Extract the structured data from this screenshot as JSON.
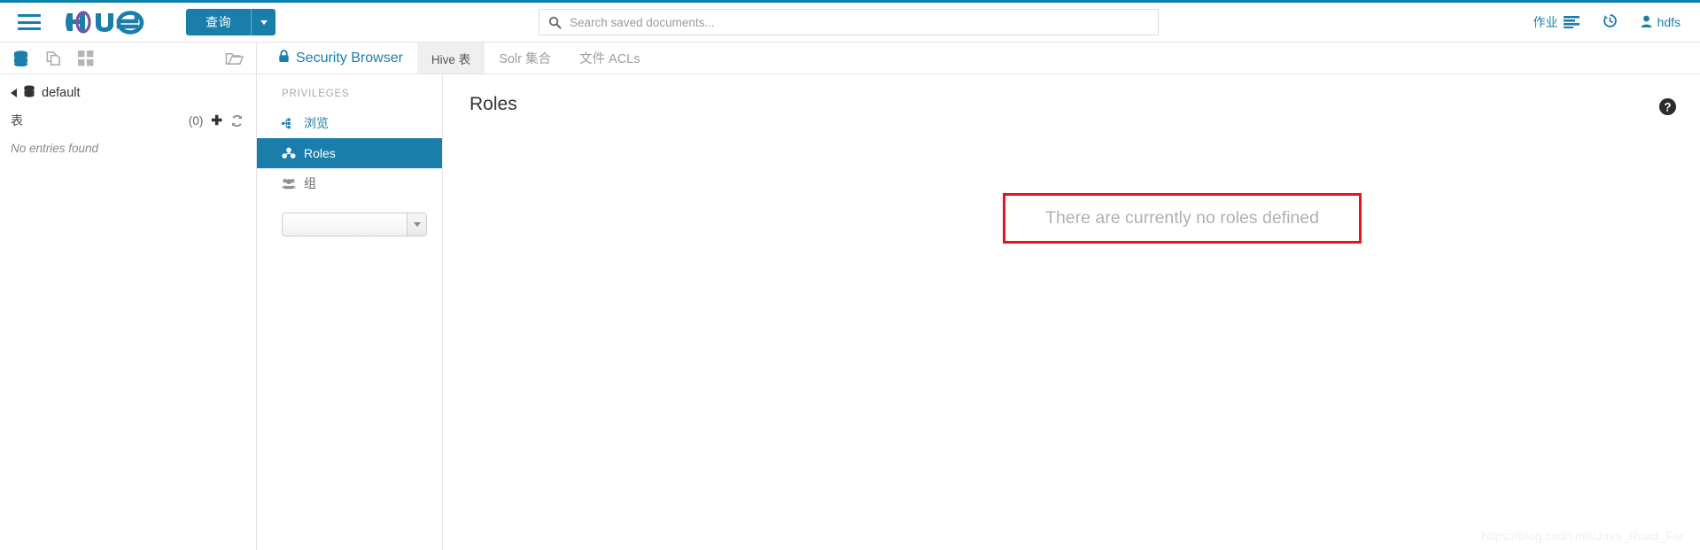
{
  "header": {
    "menu_icon": "hamburger-icon",
    "logo_text": "hue",
    "query_button_label": "查询",
    "query_caret_icon": "chevron-down-icon",
    "search": {
      "icon": "search-icon",
      "placeholder": "Search saved documents...",
      "value": ""
    },
    "right_items": [
      {
        "label": "作业",
        "icon": "jobs-list-icon"
      },
      {
        "label": "",
        "icon": "history-clock-icon"
      },
      {
        "label": "hdfs",
        "icon": "user-icon"
      }
    ],
    "accent_color": "#1a7eab"
  },
  "assist": {
    "toolbar_icons": [
      {
        "name": "database-icon",
        "active": true
      },
      {
        "name": "documents-icon",
        "active": false
      },
      {
        "name": "grid-apps-icon",
        "active": false
      },
      {
        "name": "open-folder-icon",
        "active": false
      }
    ],
    "back_icon": "chevron-left-icon",
    "database_icon": "database-icon",
    "database_name": "default",
    "tables_label": "表",
    "tables_count": "(0)",
    "add_icon": "plus-icon",
    "refresh_icon": "refresh-icon",
    "empty_message": "No entries found"
  },
  "tabs": [
    {
      "label": "Security Browser",
      "icon": "lock-icon",
      "active": false,
      "brand": true
    },
    {
      "label": "Hive 表",
      "active": true
    },
    {
      "label": "Solr 集合",
      "active": false
    },
    {
      "label": "文件 ACLs",
      "active": false
    }
  ],
  "privileges": {
    "section_title": "PRIVILEGES",
    "items": [
      {
        "label": "浏览",
        "icon": "browse-icon",
        "active": false
      },
      {
        "label": "Roles",
        "icon": "roles-cubes-icon",
        "active": true
      },
      {
        "label": "组",
        "icon": "group-users-icon",
        "active": false
      }
    ],
    "group_select": {
      "value": "",
      "caret_icon": "chevron-down-icon"
    },
    "active_color": "#1a7eab"
  },
  "content": {
    "title": "Roles",
    "help_icon": "question-circle-icon",
    "empty_state_message": "There are currently no roles defined",
    "annotation_color": "#e8141b"
  },
  "watermark": "https://blog.csdn.net/Java_Road_Far"
}
